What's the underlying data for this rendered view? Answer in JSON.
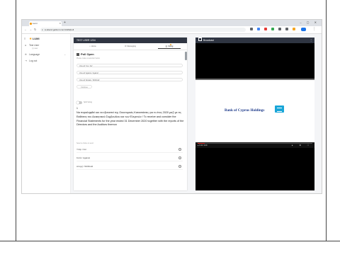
{
  "browser": {
    "tab_title": "Lumi",
    "new_tab_glyph": "+",
    "url": "● attend.getlumi.com/AGM/poll",
    "window_controls": "– ▢ ✕"
  },
  "app": {
    "brand": "LUMI",
    "sidebar": [
      {
        "label": "Test User",
        "sub": "(•) user"
      },
      {
        "label": "Language"
      },
      {
        "label": "Log out"
      }
    ]
  },
  "poll_panel": {
    "header": "TEST USER 1234",
    "tabs": [
      {
        "label": "Home",
        "icon": "home-icon"
      },
      {
        "label": "Messaging",
        "icon": "chat-icon"
      },
      {
        "label": "Voting",
        "icon": "vote-icon"
      }
    ],
    "title": "Poll Open",
    "description": "Please make a selection below",
    "quick_options": [
      "Vote all 'Yes / For'",
      "Vote all 'Against / Against'",
      "Vote all 'Abstain / Withhold'"
    ],
    "small_button": "Continue",
    "toggle_label": "Split Voting",
    "question_number": "1",
    "question_text": "Να παραληφθεί και να εξεταστεί της Οικονομικές Καταστάσεις για το έτος 2020 μαζί με τις Εκθέσεις του Διοικητικού Συμβουλίου και των Ελεγκτών / To receive and consider the Financial Statements for the year ended 31 December 2020 together with the reports of the Directors and the Auditors thereon",
    "choose_label": "Select a choice to send",
    "options": [
      "Υπέρ / For",
      "Κατά / Against",
      "Αποχή / Withhold"
    ]
  },
  "broadcast": {
    "header": "Broadcast",
    "menu": "⋮",
    "slide_company": "Bank of Cyprus Holdings",
    "time": "● 1:04 / 9:29",
    "progress_fraction": 0.06,
    "controls": "▸ ⚙ ⛶"
  },
  "colors": {
    "header_bg": "#2f3542",
    "accent_orange": "#f5a623",
    "boc_blue": "#1d3a8a",
    "boc_logo": "#19a6d8"
  }
}
